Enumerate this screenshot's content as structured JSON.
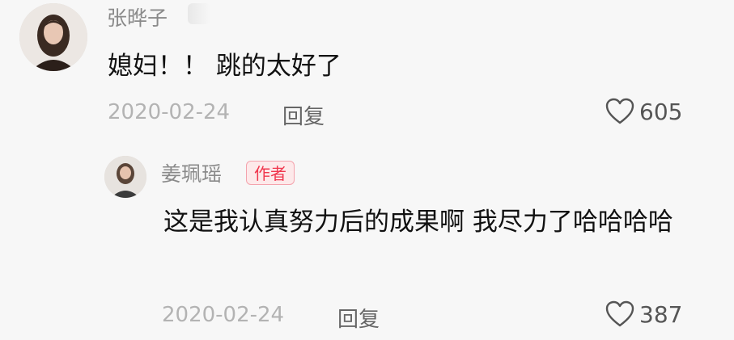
{
  "comments": [
    {
      "username": "张晔子",
      "text": "媳妇！！ 跳的太好了",
      "date": "2020-02-24",
      "reply_label": "回复",
      "likes": "605"
    },
    {
      "username": "姜珮瑶",
      "badge": "作者",
      "text": "这是我认真努力后的成果啊 我尽力了哈哈哈哈",
      "date": "2020-02-24",
      "reply_label": "回复",
      "likes": "387"
    }
  ],
  "icons": {
    "like": "heart-outline-icon"
  },
  "colors": {
    "badge_text": "#f0364d",
    "badge_bg": "#fde9ea",
    "meta": "#b3b3b3"
  }
}
